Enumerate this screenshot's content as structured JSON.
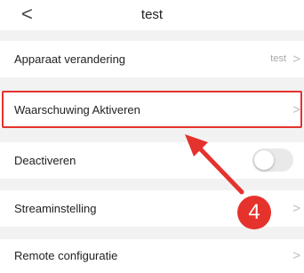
{
  "header": {
    "title": "test",
    "back_glyph": "<"
  },
  "rows": [
    {
      "label": "Apparaat verandering",
      "value": "test",
      "chevron": ">"
    },
    {
      "label": "Waarschuwing Aktiveren",
      "chevron": ">"
    },
    {
      "label": "Deactiveren",
      "toggle_on": false
    },
    {
      "label": "Streaminstelling",
      "chevron": ">"
    },
    {
      "label": "Remote configuratie",
      "chevron": ">"
    }
  ],
  "annotation": {
    "step_number": "4",
    "color": "#e5322d"
  }
}
